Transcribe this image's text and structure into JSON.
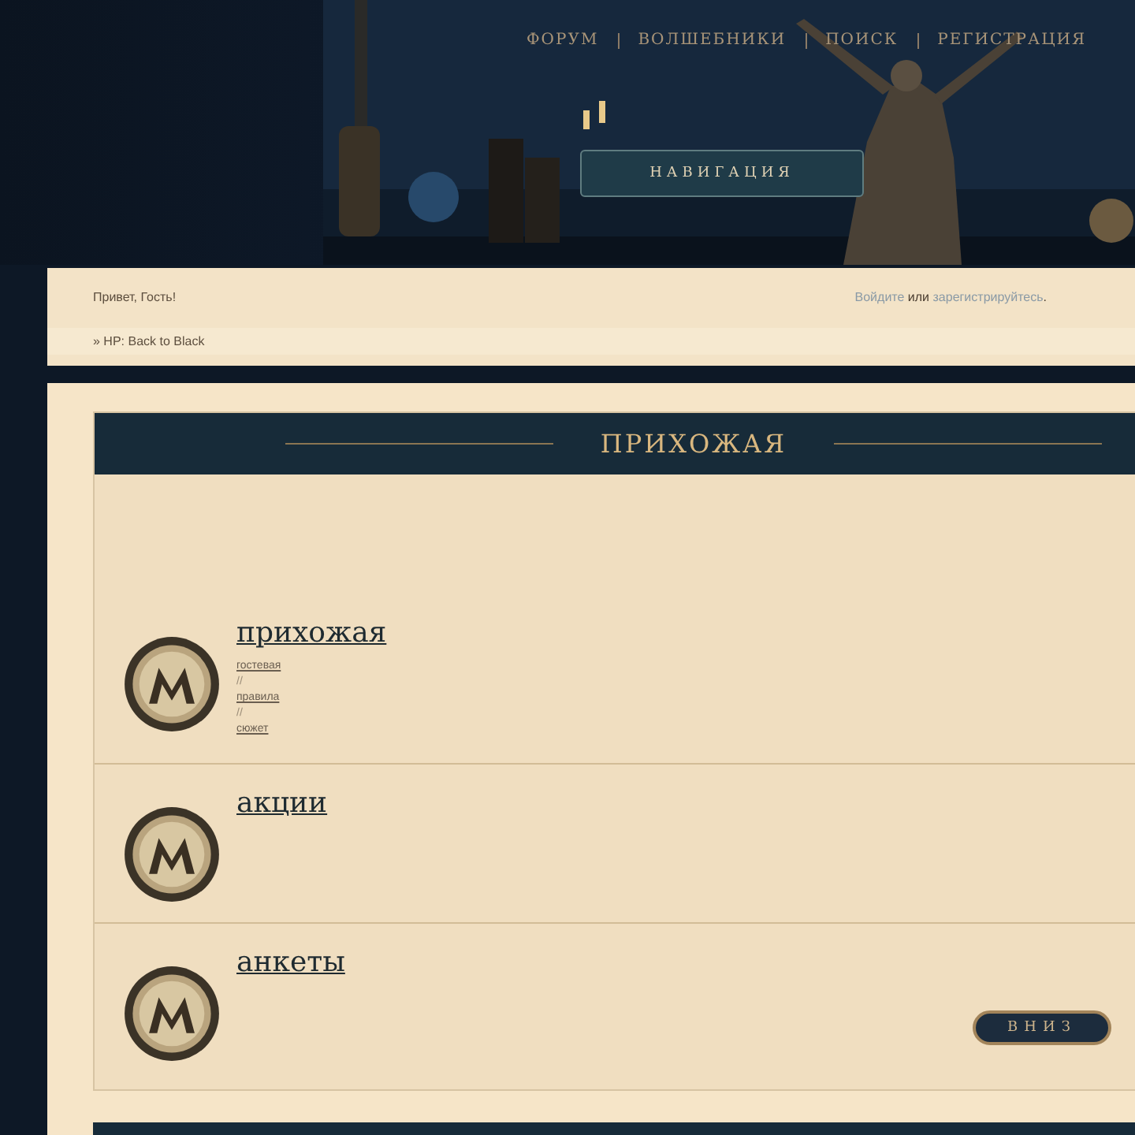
{
  "header": {
    "nav": [
      "ФОРУМ",
      "ВОЛШЕБНИКИ",
      "ПОИСК",
      "РЕГИСТРАЦИЯ"
    ],
    "nav_button": "НАВИГАЦИЯ"
  },
  "info_bar": {
    "greeting": "Привет, Гость!",
    "login_link": "Войдите",
    "or": "или",
    "register_link": "зарегистрируйтесь",
    "end": ".",
    "breadcrumb": "» HP: Back to Black"
  },
  "category": {
    "title": "ПРИХОЖАЯ",
    "forums": [
      {
        "title": "прихожая",
        "links": [
          "гостевая",
          "правила",
          "сюжет"
        ],
        "separator": "//"
      },
      {
        "title": "акции"
      },
      {
        "title": "анкеты"
      }
    ],
    "down_button": "ВНИЗ"
  }
}
